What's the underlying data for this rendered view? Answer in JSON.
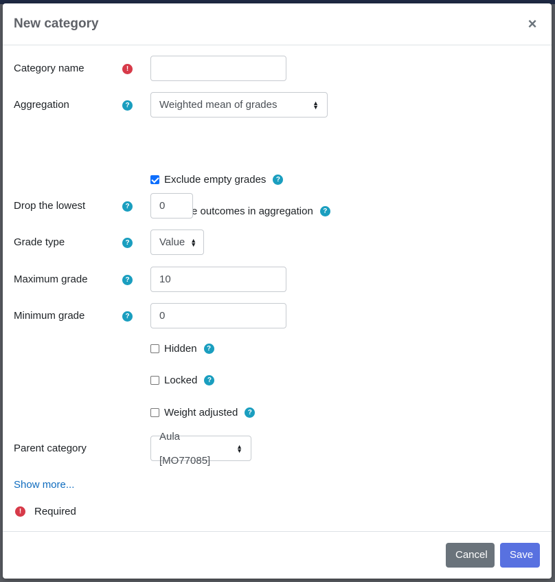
{
  "dialog": {
    "title": "New category",
    "close_symbol": "×"
  },
  "form": {
    "category_name": {
      "label": "Category name",
      "value": "",
      "placeholder": ""
    },
    "aggregation": {
      "label": "Aggregation",
      "selected": "Weighted mean of grades"
    },
    "exclude_empty": {
      "label": "Exclude empty grades",
      "checked": true
    },
    "include_outcomes": {
      "label": "Include outcomes in aggregation",
      "checked": false
    },
    "drop_lowest": {
      "label": "Drop the lowest",
      "value": "0"
    },
    "grade_type": {
      "label": "Grade type",
      "selected": "Value"
    },
    "maximum_grade": {
      "label": "Maximum grade",
      "value": "10"
    },
    "minimum_grade": {
      "label": "Minimum grade",
      "value": "0"
    },
    "hidden": {
      "label": "Hidden",
      "checked": false
    },
    "locked": {
      "label": "Locked",
      "checked": false
    },
    "weight_adjusted": {
      "label": "Weight adjusted",
      "checked": false
    },
    "parent_category": {
      "label": "Parent category",
      "selected": "Aula [MO77085]"
    }
  },
  "show_more": "Show more...",
  "required_note": "Required",
  "footer": {
    "cancel_label": "Cancel",
    "save_label": "Save"
  },
  "icons": {
    "help": "question-circle-icon",
    "required": "exclamation-circle-icon"
  },
  "colors": {
    "help_badge": "#1a9ebf",
    "required_badge": "#d73a49",
    "save_button": "#5871e0",
    "cancel_button": "#6a737b",
    "link": "#0f6cbf"
  }
}
